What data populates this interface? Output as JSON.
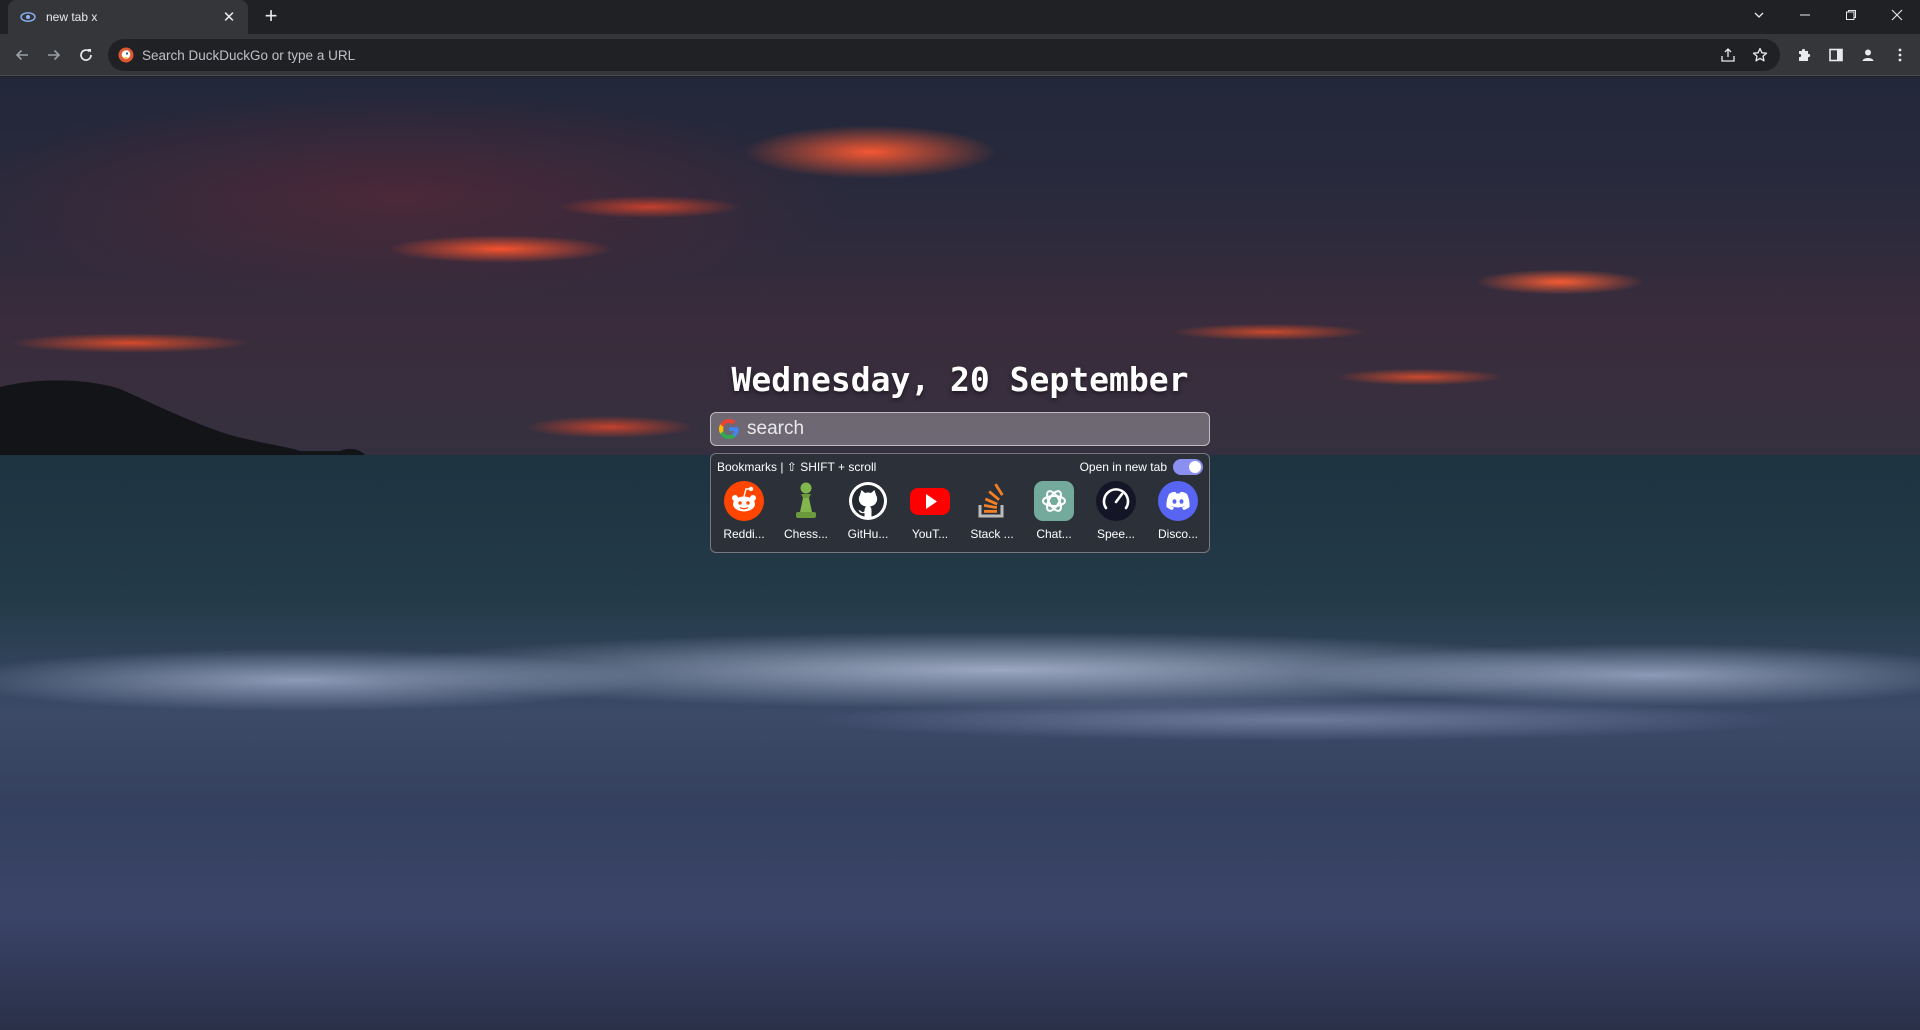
{
  "tab": {
    "title": "new tab x",
    "close_glyph": "✕"
  },
  "tabstrip": {
    "new_tab_glyph": "+"
  },
  "toolbar": {
    "omnibox_placeholder": "Search DuckDuckGo or type a URL"
  },
  "page": {
    "date": "Wednesday, 20 September",
    "search": {
      "placeholder": "search"
    },
    "bookmarks": {
      "header": "Bookmarks | ⇧ SHIFT + scroll",
      "open_new_tab_label": "Open in new tab",
      "open_new_tab_enabled": true,
      "items": [
        {
          "label": "Reddi...",
          "icon": "reddit-icon",
          "color": "#ff4500"
        },
        {
          "label": "Chess...",
          "icon": "chess-pawn-icon",
          "color": "#81b64c"
        },
        {
          "label": "GitHu...",
          "icon": "github-icon",
          "color": "#ffffff"
        },
        {
          "label": "YouT...",
          "icon": "youtube-icon",
          "color": "#ff0000"
        },
        {
          "label": "Stack ...",
          "icon": "stackoverflow-icon",
          "color": "#f48024"
        },
        {
          "label": "Chat...",
          "icon": "chatgpt-icon",
          "color": "#74aa9c"
        },
        {
          "label": "Spee...",
          "icon": "speedtest-icon",
          "color": "#141526"
        },
        {
          "label": "Disco...",
          "icon": "discord-icon",
          "color": "#5865f2"
        }
      ]
    }
  }
}
